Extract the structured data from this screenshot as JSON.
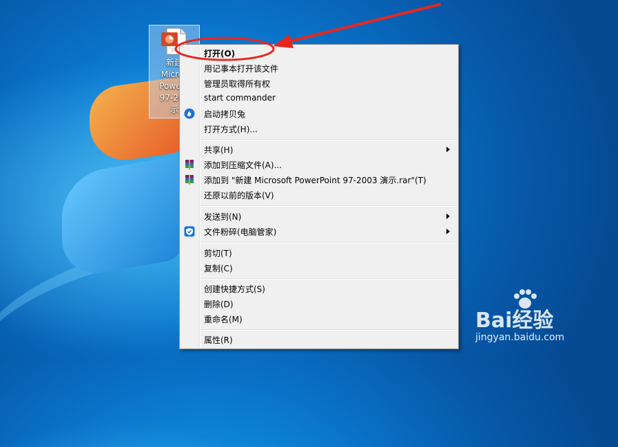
{
  "desktop": {
    "file_icon": {
      "label_lines": "新建\nMicros\nPowerP\n97-200\n示"
    }
  },
  "context_menu": {
    "items": [
      {
        "label": "打开(O)",
        "bold": true
      },
      {
        "label": "用记事本打开该文件"
      },
      {
        "label": "管理员取得所有权"
      },
      {
        "label": "start commander"
      },
      {
        "label": "启动拷贝兔",
        "icon": "copy-rabbit-icon"
      },
      {
        "label": "打开方式(H)..."
      },
      {
        "label": "共享(H)",
        "submenu": true
      },
      {
        "label": "添加到压缩文件(A)...",
        "icon": "winrar-icon"
      },
      {
        "label": "添加到 \"新建 Microsoft PowerPoint 97-2003 演示.rar\"(T)",
        "icon": "winrar-icon"
      },
      {
        "label": "还原以前的版本(V)"
      },
      {
        "label": "发送到(N)",
        "submenu": true
      },
      {
        "label": "文件粉碎(电脑管家)",
        "icon": "tencent-shield-icon",
        "submenu": true
      },
      {
        "label": "剪切(T)"
      },
      {
        "label": "复制(C)"
      },
      {
        "label": "创建快捷方式(S)"
      },
      {
        "label": "删除(D)"
      },
      {
        "label": "重命名(M)"
      },
      {
        "label": "属性(R)"
      }
    ]
  },
  "annotation": {
    "color": "#e8261e",
    "target": "打开(O)"
  },
  "watermark": {
    "logo": "Bai经验",
    "url": "jingyan.baidu.com"
  }
}
